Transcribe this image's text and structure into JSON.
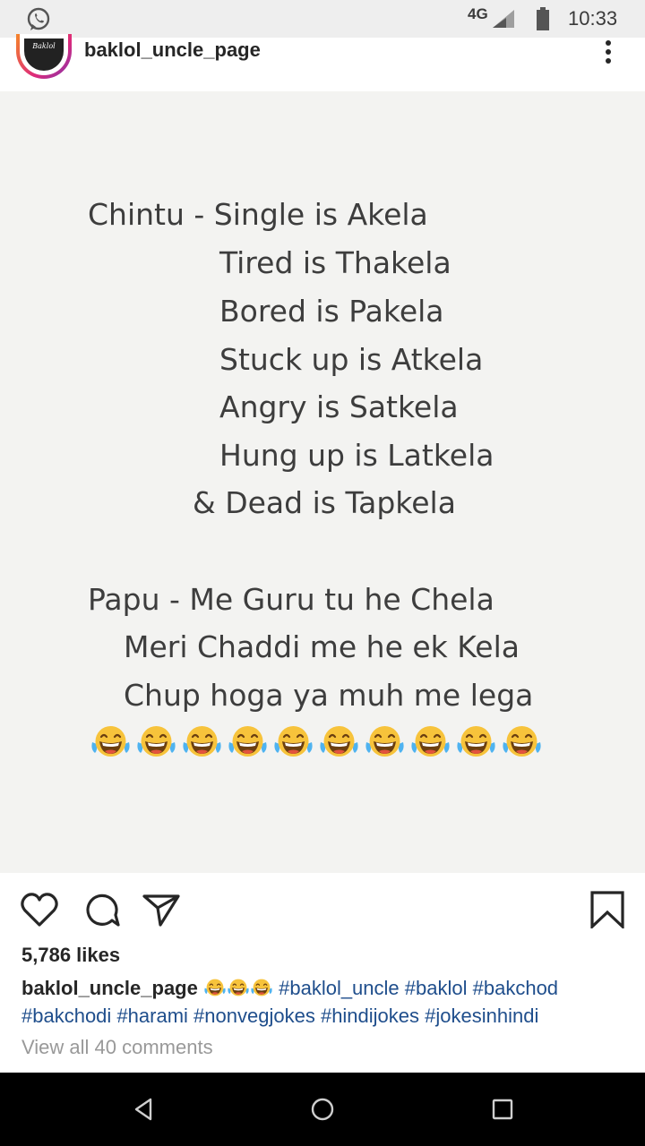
{
  "status_bar": {
    "network": "4G",
    "time": "10:33",
    "icons": [
      "whatsapp-icon",
      "signal-icon",
      "battery-icon"
    ]
  },
  "post": {
    "username": "baklol_uncle_page",
    "avatar_text": "Baklol",
    "meme": {
      "lines": [
        "Chintu - Single is Akela",
        "Tired is Thakela",
        "Bored is Pakela",
        "Stuck up is Atkela",
        "Angry is Satkela",
        "Hung up is Latkela",
        "& Dead is Tapkela",
        "Papu -  Me Guru tu he Chela",
        "Meri Chaddi me he ek Kela",
        "Chup hoga ya muh me lega"
      ],
      "emoji_icon": "face-with-tears-of-joy-icon",
      "emoji_count": 10
    },
    "likes": "5,786 likes",
    "caption": {
      "username": "baklol_uncle_page",
      "emoji_count": 3,
      "hashtags": [
        "#baklol_uncle",
        "#baklol",
        "#bakchod",
        "#bakchodi",
        "#harami",
        "#nonvegjokes",
        "#hindijokes",
        "#jokesinhindi"
      ]
    },
    "view_comments": "View all 40 comments"
  },
  "colors": {
    "status_bar_bg": "#eeeeee",
    "meme_bg": "#f3f3f1",
    "hashtag": "#1f4e8c",
    "nav_bar_bg": "#000000"
  }
}
